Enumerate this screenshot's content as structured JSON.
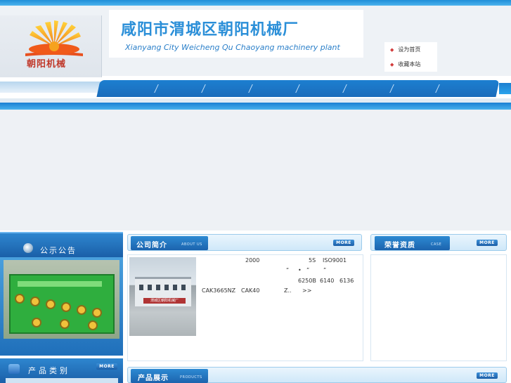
{
  "header": {
    "logo_text": "朝阳机械",
    "title_cn": "咸阳市渭城区朝阳机械厂",
    "title_en": "Xianyang City Weicheng Qu Chaoyang machinery plant"
  },
  "quick_links": [
    {
      "label": "设为首页"
    },
    {
      "label": "收藏本站"
    }
  ],
  "notice": {
    "title": "公示公告"
  },
  "categories": {
    "title": "产品类别",
    "more": "MORE"
  },
  "about": {
    "title": "公司简介",
    "subtitle": "ABOUT US",
    "more": "MORE",
    "photo_sign": "渭城区朝阳机械厂",
    "lines": [
      {
        "a": "2000",
        "b": "5S",
        "c": "ISO9001"
      },
      {
        "a": "“",
        "b": "•",
        "c": "”",
        "d": "”"
      },
      {
        "a": "6250B",
        "b": "6140",
        "c": "6136"
      },
      {
        "a": "CAK3665NZ",
        "b": "CAK40",
        "c": "Z.."
      }
    ],
    "read_more": ">>"
  },
  "honor": {
    "title": "荣誉资质",
    "subtitle": "CASE",
    "more": "MORE"
  },
  "products": {
    "title": "产品展示",
    "subtitle": "PRODUCTS",
    "more": "MORE"
  },
  "colors": {
    "brand_blue": "#1d7fd0",
    "title_blue": "#2b8fd8",
    "logo_red": "#c0392b"
  }
}
